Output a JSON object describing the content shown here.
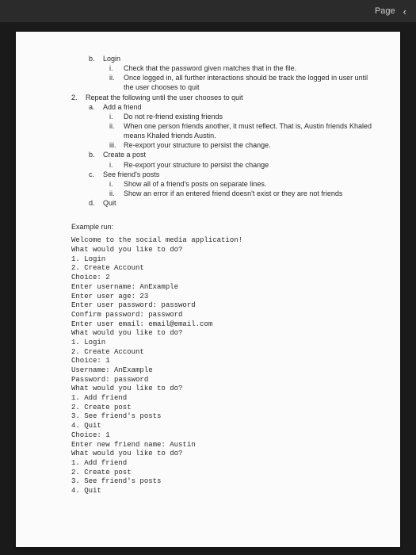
{
  "header": {
    "page_label": "Page"
  },
  "outline": {
    "b": {
      "mark": "b.",
      "label": "Login",
      "i": {
        "mark": "i.",
        "text": "Check that the password given matches that in the file."
      },
      "ii": {
        "mark": "ii.",
        "text": "Once logged in, all further interactions should be track the logged in user until the user chooses to quit"
      }
    },
    "two": {
      "mark": "2.",
      "text": "Repeat the following until the user chooses to quit",
      "a": {
        "mark": "a.",
        "label": "Add a friend",
        "i": {
          "mark": "i.",
          "text": "Do not re-friend existing friends"
        },
        "ii": {
          "mark": "ii.",
          "text": "When one person friends another, it must reflect. That is, Austin friends Khaled means Khaled friends Austin."
        },
        "iii": {
          "mark": "iii.",
          "text": "Re-export your structure to persist the change."
        }
      },
      "b": {
        "mark": "b.",
        "label": "Create a post",
        "i": {
          "mark": "i.",
          "text": "Re-export your structure to persist the change"
        }
      },
      "c": {
        "mark": "c.",
        "label": "See friend's posts",
        "i": {
          "mark": "i.",
          "text": "Show all of a friend's posts on separate lines."
        },
        "ii": {
          "mark": "ii.",
          "text": "Show an error if an entered friend doesn't exist or they are not friends"
        }
      },
      "d": {
        "mark": "d.",
        "label": "Quit"
      }
    }
  },
  "example": {
    "heading": "Example run:",
    "lines": [
      "Welcome to the social media application!",
      "What would you like to do?",
      "1. Login",
      "2. Create Account",
      "Choice: 2",
      "Enter username: AnExample",
      "Enter user age: 23",
      "Enter user password: password",
      "Confirm password: password",
      "Enter user email: email@email.com",
      "What would you like to do?",
      "1. Login",
      "2. Create Account",
      "Choice: 1",
      "Username: AnExample",
      "Password: password",
      "What would you like to do?",
      "1. Add friend",
      "2. Create post",
      "3. See friend's posts",
      "4. Quit",
      "Choice: 1",
      "Enter new friend name: Austin",
      "What would you like to do?",
      "1. Add friend",
      "2. Create post",
      "3. See friend's posts",
      "4. Quit"
    ]
  }
}
